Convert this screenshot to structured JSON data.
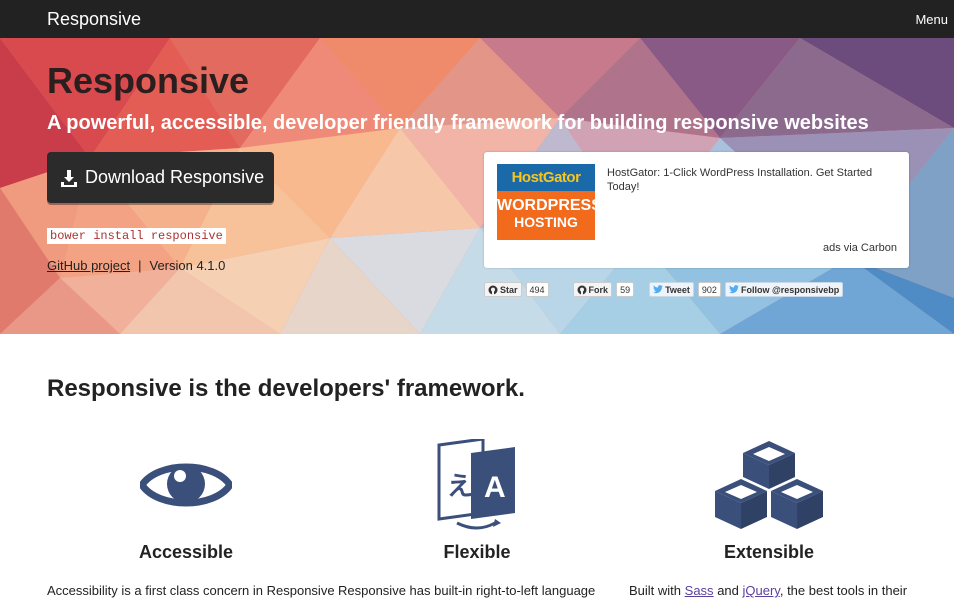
{
  "navbar": {
    "brand": "Responsive",
    "menu": "Menu"
  },
  "hero": {
    "title": "Responsive",
    "subtitle": "A powerful, accessible, developer friendly framework for building responsive websites",
    "download_label": "Download Responsive",
    "bower_cmd": "bower install responsive",
    "github_link": "GitHub project",
    "separator": "|",
    "version": "Version 4.1.0"
  },
  "ad": {
    "image_top": "HostGator",
    "image_line1": "WORDPRESS",
    "image_line2": "HOSTING",
    "text": "HostGator: 1-Click WordPress Installation. Get Started Today!",
    "via": "ads via Carbon"
  },
  "social": {
    "star_label": "Star",
    "star_count": "494",
    "fork_label": "Fork",
    "fork_count": "59",
    "tweet_label": "Tweet",
    "tweet_count": "902",
    "follow_label": "Follow @responsivebp"
  },
  "main": {
    "heading": "Responsive is the developers' framework.",
    "features": [
      {
        "title": "Accessible",
        "text": "Accessibility is a first class concern in Responsive",
        "icon": "eye-icon"
      },
      {
        "title": "Flexible",
        "text": "Responsive has built-in right-to-left language",
        "icon": "translate-icon"
      },
      {
        "title": "Extensible",
        "text_prefix": "Built with",
        "link1": "Sass",
        "text_and": "and",
        "link2": "jQuery",
        "text_suffix": ", the best tools in their",
        "icon": "cubes-icon"
      }
    ]
  },
  "colors": {
    "accent": "#3a4f7a",
    "navbar": "#222222",
    "button": "#2b2b2b"
  }
}
